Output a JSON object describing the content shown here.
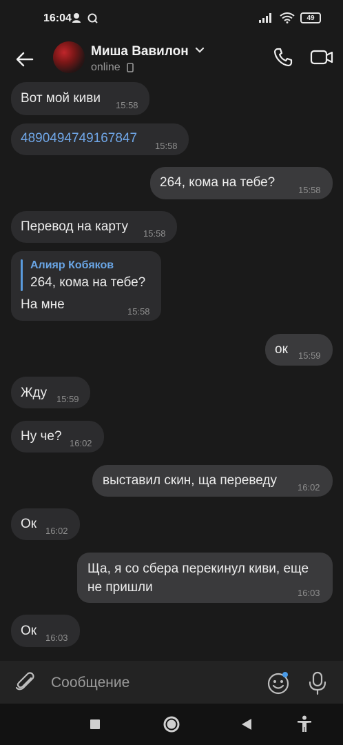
{
  "status_bar": {
    "time": "16:04",
    "battery": "49",
    "icons": [
      "person-alert-icon",
      "sync-icon",
      "signal-icon",
      "wifi-icon",
      "battery-icon"
    ]
  },
  "header": {
    "contact_name": "Миша Вавилон",
    "contact_status": "online",
    "icons": [
      "back-arrow-icon",
      "chevron-down-icon",
      "phone-icon",
      "video-camera-icon",
      "device-icon"
    ]
  },
  "messages": [
    {
      "direction": "in",
      "text": "Вот мой киви",
      "time": "15:58"
    },
    {
      "direction": "in",
      "text": "4890494749167847",
      "time": "15:58",
      "is_link": true
    },
    {
      "direction": "out",
      "text": "264, кома на тебе?",
      "time": "15:58"
    },
    {
      "direction": "in",
      "text": "Перевод на карту",
      "time": "15:58"
    },
    {
      "direction": "in",
      "reply_to_name": "Алияр Кобяков",
      "reply_to_text": "264, кома на тебе?",
      "text": "На мне",
      "time": "15:58"
    },
    {
      "direction": "out",
      "text": "ок",
      "time": "15:59"
    },
    {
      "direction": "in",
      "text": "Жду",
      "time": "15:59"
    },
    {
      "direction": "in",
      "text": "Ну че?",
      "time": "16:02"
    },
    {
      "direction": "out",
      "text": "выставил скин, ща переведу",
      "time": "16:02"
    },
    {
      "direction": "in",
      "text": "Ок",
      "time": "16:02"
    },
    {
      "direction": "out",
      "text_line1": "Ща, я со сбера перекинул киви, еще",
      "text_line2": "не пришли",
      "time": "16:03"
    },
    {
      "direction": "in",
      "text": "Ок",
      "time": "16:03"
    }
  ],
  "composer": {
    "placeholder": "Сообщение",
    "icons": [
      "paperclip-icon",
      "emoji-icon",
      "microphone-icon"
    ]
  },
  "navbar": {
    "icons": [
      "recents-square-icon",
      "home-circle-icon",
      "back-triangle-icon",
      "accessibility-icon"
    ]
  },
  "colors": {
    "background": "#1a1a1a",
    "bubble_in": "#2c2c2e",
    "bubble_out": "#3a3a3c",
    "link": "#70a7e8",
    "accent": "#5a9bdd"
  }
}
